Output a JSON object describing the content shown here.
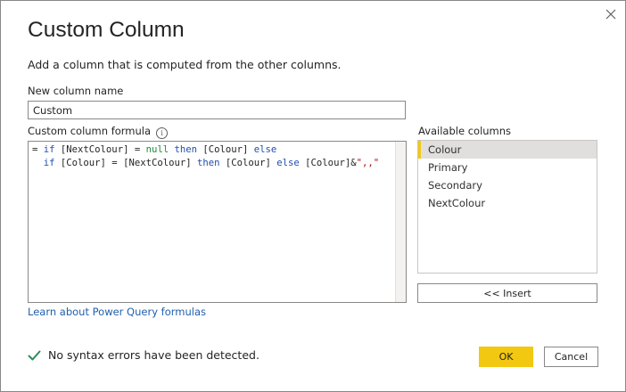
{
  "dialog": {
    "title": "Custom Column",
    "subtitle": "Add a column that is computed from the other columns.",
    "close_icon": "close-icon"
  },
  "name_field": {
    "label": "New column name",
    "value": "Custom"
  },
  "formula": {
    "label": "Custom column formula",
    "info_icon": "info-icon",
    "info_glyph": "i",
    "lines": [
      [
        {
          "t": "txt",
          "v": "= "
        },
        {
          "t": "kw",
          "v": "if"
        },
        {
          "t": "txt",
          "v": " [NextColour] = "
        },
        {
          "t": "null",
          "v": "null"
        },
        {
          "t": "txt",
          "v": " "
        },
        {
          "t": "kw",
          "v": "then"
        },
        {
          "t": "txt",
          "v": " [Colour] "
        },
        {
          "t": "kw",
          "v": "else"
        }
      ],
      [
        {
          "t": "txt",
          "v": "  "
        },
        {
          "t": "kw",
          "v": "if"
        },
        {
          "t": "txt",
          "v": " [Colour] = [NextColour] "
        },
        {
          "t": "kw",
          "v": "then"
        },
        {
          "t": "txt",
          "v": " [Colour] "
        },
        {
          "t": "kw",
          "v": "else"
        },
        {
          "t": "txt",
          "v": " [Colour]&"
        },
        {
          "t": "str",
          "v": "\",,\""
        }
      ]
    ]
  },
  "learn_link": "Learn about Power Query formulas",
  "available_columns": {
    "label": "Available columns",
    "items": [
      "Colour",
      "Primary",
      "Secondary",
      "NextColour"
    ],
    "selected_index": 0,
    "insert_label": "<< Insert"
  },
  "status": {
    "icon": "checkmark-icon",
    "text": "No syntax errors have been detected."
  },
  "buttons": {
    "ok": "OK",
    "cancel": "Cancel"
  },
  "colors": {
    "accent": "#f2c811",
    "keyword": "#1f4fae",
    "null_literal": "#1e8e3e",
    "string_literal": "#a31515",
    "link": "#1f5fae",
    "success": "#2e8b57"
  }
}
